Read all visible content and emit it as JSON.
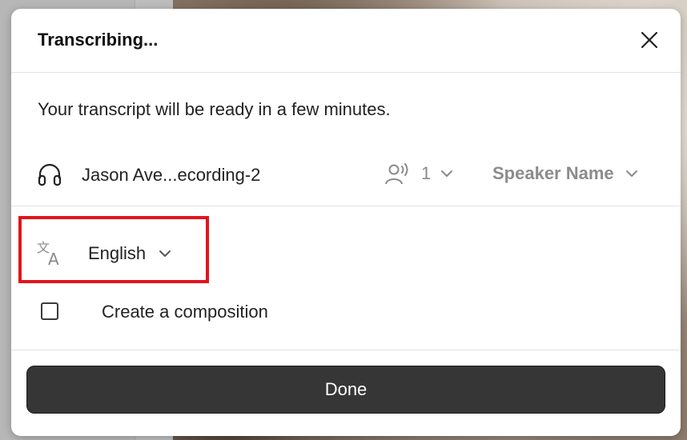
{
  "dialog": {
    "title": "Transcribing...",
    "subtitle": "Your transcript will be ready in a few minutes.",
    "recording": {
      "icon": "headphones-icon",
      "name": "Jason Ave...ecording-2",
      "speaker_count": "1",
      "speaker_count_icon": "speakers-icon",
      "speaker_name_label": "Speaker Name"
    },
    "language": {
      "icon": "translate-icon",
      "selected": "English"
    },
    "composition": {
      "label": "Create a composition",
      "checked": false
    },
    "done_label": "Done"
  },
  "colors": {
    "highlight": "#e2141b",
    "done_button": "#363636"
  }
}
